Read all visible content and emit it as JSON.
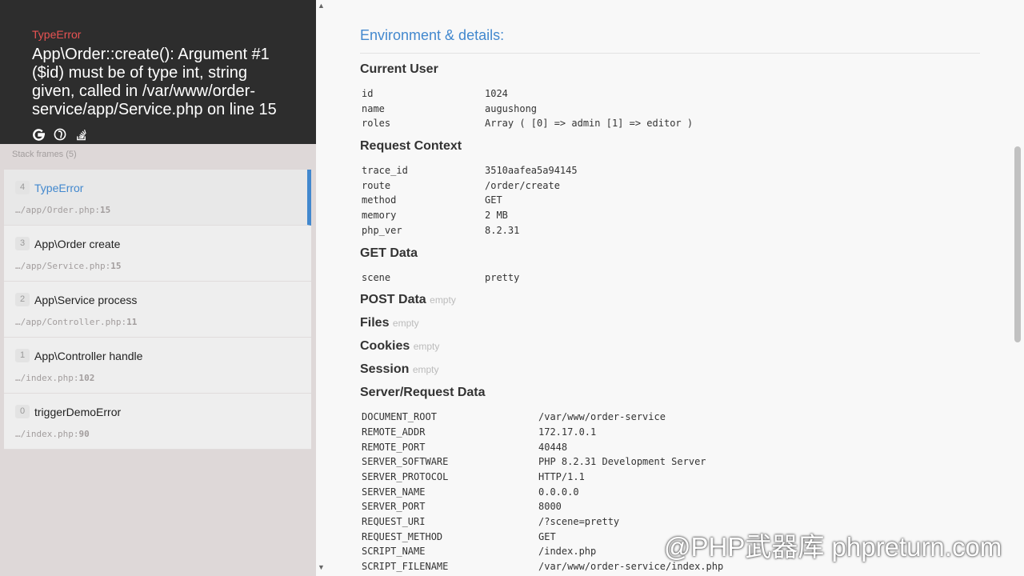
{
  "exception": {
    "type": "TypeError",
    "message": "App\\Order::create(): Argument #1 ($id) must be of type int, string given, called in /var/www/order-service/app/Service.php on line 15",
    "icons": [
      "google-icon",
      "duckduckgo-icon",
      "stackoverflow-icon"
    ]
  },
  "stack": {
    "header": "Stack frames (5)",
    "frames": [
      {
        "index": "4",
        "name": "TypeError",
        "file": "…/app/Order.php:",
        "line": "15",
        "active": true
      },
      {
        "index": "3",
        "name": "App\\Order create",
        "file": "…/app/Service.php:",
        "line": "15"
      },
      {
        "index": "2",
        "name": "App\\Service process",
        "file": "…/app/Controller.php:",
        "line": "11"
      },
      {
        "index": "1",
        "name": "App\\Controller handle",
        "file": "…/index.php:",
        "line": "102"
      },
      {
        "index": "0",
        "name": "triggerDemoError",
        "file": "…/index.php:",
        "line": "90"
      }
    ]
  },
  "details": {
    "title": "Environment & details:",
    "current_user": {
      "title": "Current User",
      "rows": [
        {
          "k": "id",
          "v": "1024"
        },
        {
          "k": "name",
          "v": "augushong"
        },
        {
          "k": "roles",
          "v": "Array ( [0] => admin [1] => editor )"
        }
      ]
    },
    "request_context": {
      "title": "Request Context",
      "rows": [
        {
          "k": "trace_id",
          "v": "3510aafea5a94145"
        },
        {
          "k": "route",
          "v": "/order/create"
        },
        {
          "k": "method",
          "v": "GET"
        },
        {
          "k": "memory",
          "v": "2 MB"
        },
        {
          "k": "php_ver",
          "v": "8.2.31"
        }
      ]
    },
    "get_data": {
      "title": "GET Data",
      "rows": [
        {
          "k": "scene",
          "v": "pretty"
        }
      ]
    },
    "post_data": {
      "title": "POST Data",
      "empty": "empty"
    },
    "files": {
      "title": "Files",
      "empty": "empty"
    },
    "cookies": {
      "title": "Cookies",
      "empty": "empty"
    },
    "session": {
      "title": "Session",
      "empty": "empty"
    },
    "server": {
      "title": "Server/Request Data",
      "rows": [
        {
          "k": "DOCUMENT_ROOT",
          "v": "/var/www/order-service"
        },
        {
          "k": "REMOTE_ADDR",
          "v": "172.17.0.1"
        },
        {
          "k": "REMOTE_PORT",
          "v": "40448"
        },
        {
          "k": "SERVER_SOFTWARE",
          "v": "PHP 8.2.31 Development Server"
        },
        {
          "k": "SERVER_PROTOCOL",
          "v": "HTTP/1.1"
        },
        {
          "k": "SERVER_NAME",
          "v": "0.0.0.0"
        },
        {
          "k": "SERVER_PORT",
          "v": "8000"
        },
        {
          "k": "REQUEST_URI",
          "v": "/?scene=pretty"
        },
        {
          "k": "REQUEST_METHOD",
          "v": "GET"
        },
        {
          "k": "SCRIPT_NAME",
          "v": "/index.php"
        },
        {
          "k": "SCRIPT_FILENAME",
          "v": "/var/www/order-service/index.php"
        }
      ]
    }
  },
  "watermark": "@PHP武器库 phpreturn.com",
  "colors": {
    "accent": "#4288ce",
    "error": "#e95353",
    "header_bg": "#2d2d2d"
  }
}
